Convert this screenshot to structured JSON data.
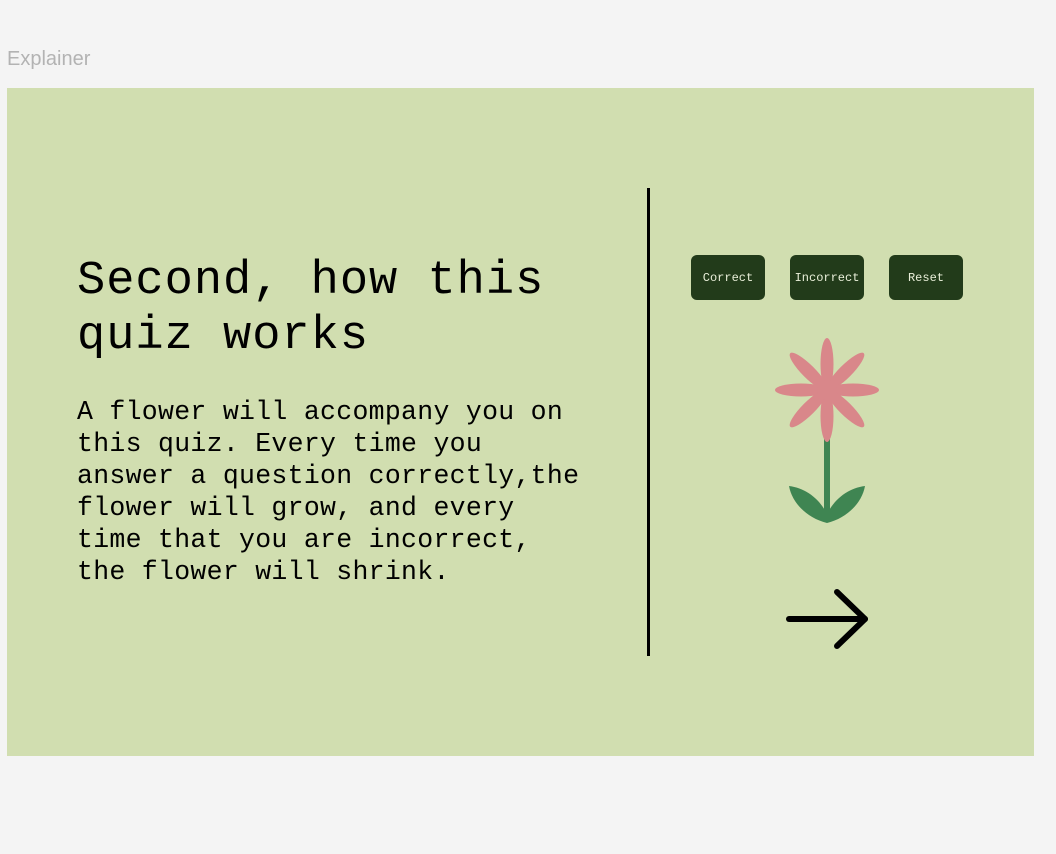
{
  "frame": {
    "label": "Explainer"
  },
  "slide": {
    "title": "Second, how this\nquiz works",
    "body": "A flower will accompany you on\nthis quiz. Every time you\nanswer a question correctly,the\nflower will grow, and every\ntime that you are incorrect,\nthe flower will shrink.",
    "background": "#d1deb0"
  },
  "controls": {
    "correct_label": "Correct",
    "incorrect_label": "Incorrect",
    "reset_label": "Reset",
    "button_color": "#223b1a"
  },
  "flower": {
    "petal_color": "#d9878a",
    "stem_color": "#3f8552"
  },
  "navigation": {
    "next_icon": "arrow-right-icon"
  }
}
